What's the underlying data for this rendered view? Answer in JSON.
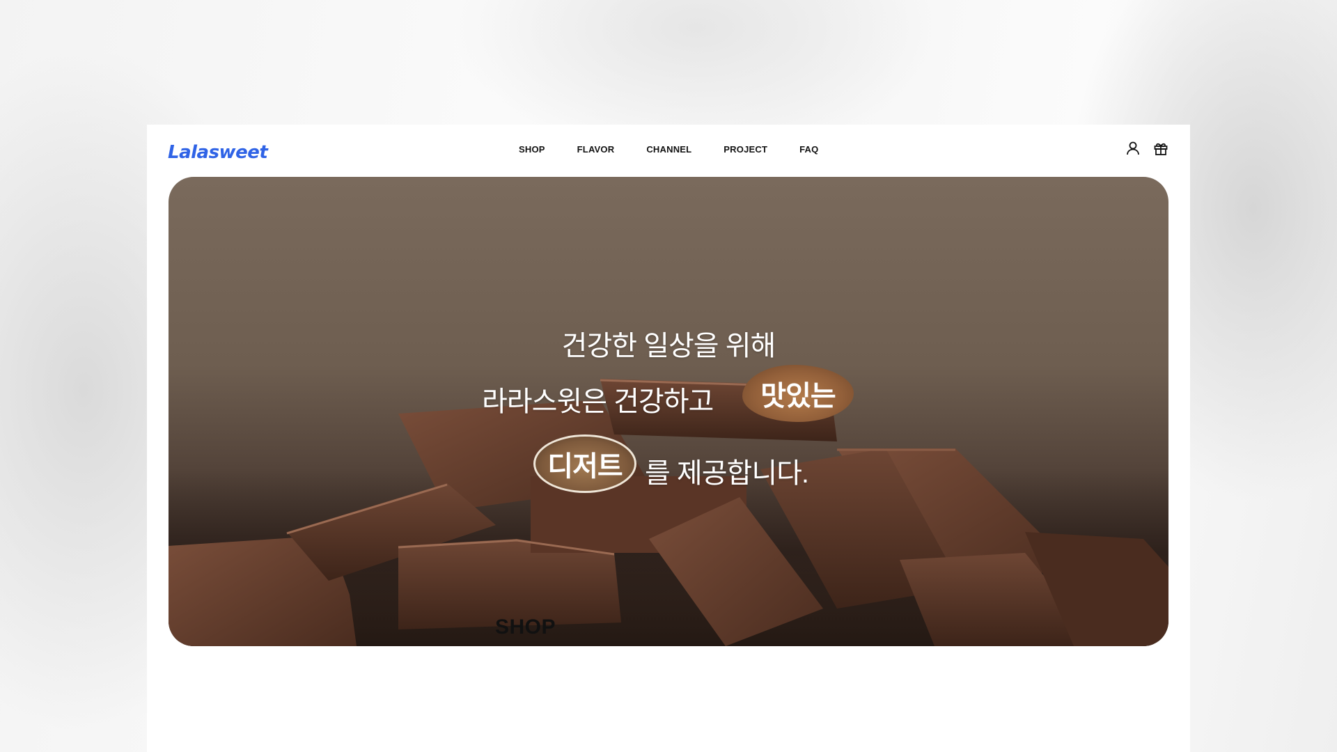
{
  "brand": {
    "logo_text": "Lalasweet",
    "accent": "#2f63e6"
  },
  "nav": {
    "items": [
      {
        "label": "SHOP"
      },
      {
        "label": "FLAVOR"
      },
      {
        "label": "CHANNEL"
      },
      {
        "label": "PROJECT"
      },
      {
        "label": "FAQ"
      }
    ]
  },
  "header_icons": [
    "user-icon",
    "gift-icon"
  ],
  "hero": {
    "line1": "건강한 일상을 위해",
    "line2_text": "라라스윗은 건강하고",
    "line2_badge": "맛있는",
    "line3_badge": "디저트",
    "line3_text": "를 제공합니다."
  },
  "section": {
    "title": "SHOP"
  }
}
